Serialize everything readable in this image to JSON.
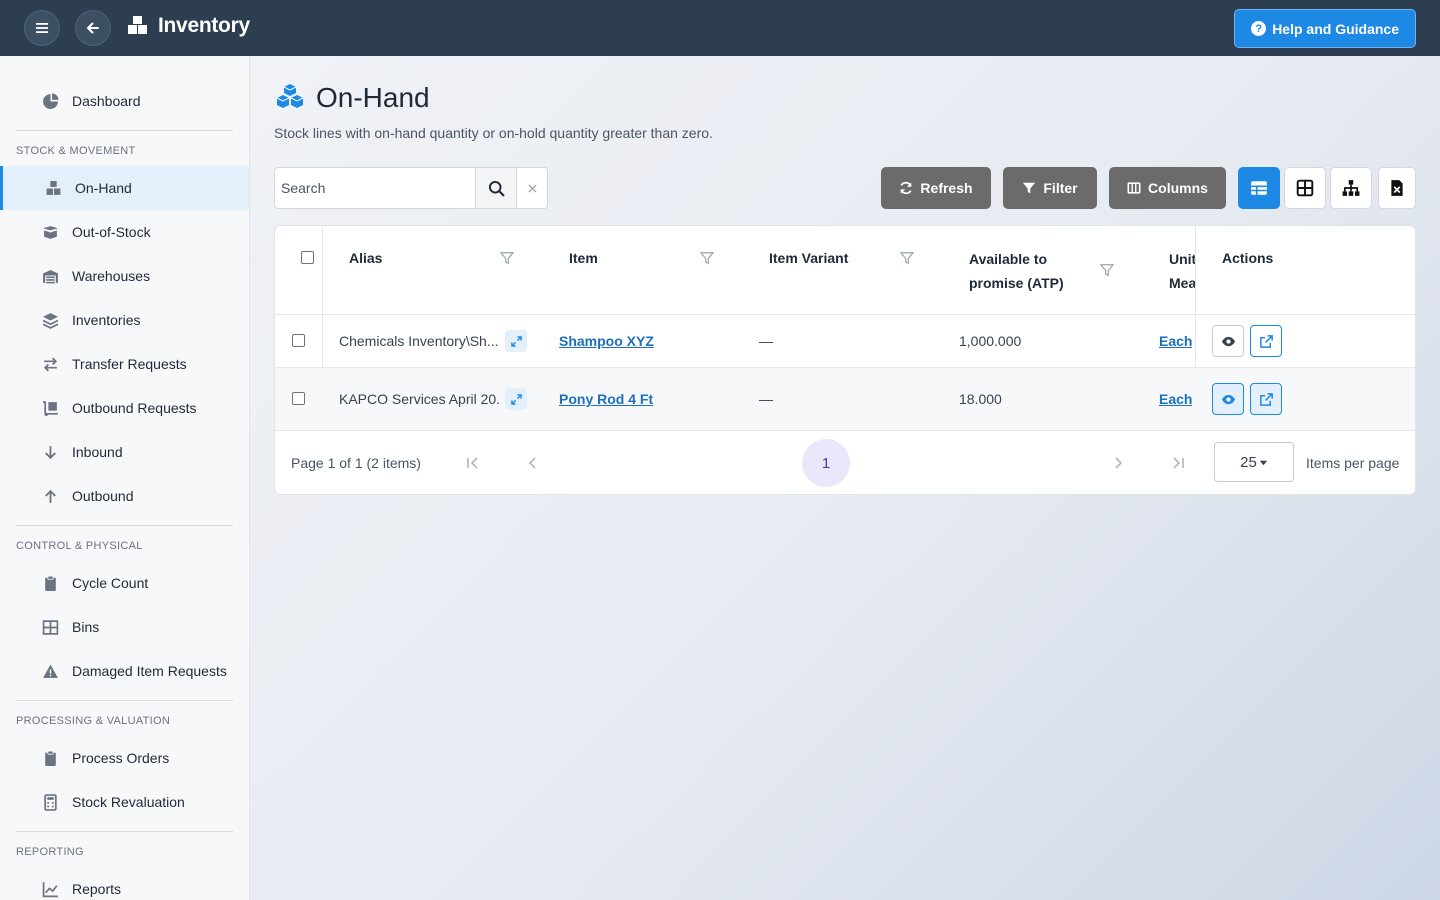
{
  "topbar": {
    "app_title": "Inventory",
    "help_label": "Help and Guidance",
    "menu_icon": "hamburger-icon",
    "back_icon": "arrow-left-icon"
  },
  "sidebar": {
    "dashboard": "Dashboard",
    "sections": [
      {
        "label": "STOCK & MOVEMENT"
      },
      {
        "label": "CONTROL & PHYSICAL"
      },
      {
        "label": "PROCESSING & VALUATION"
      },
      {
        "label": "REPORTING"
      }
    ],
    "items": [
      {
        "label": "On-Hand",
        "icon": "cubes-icon",
        "active": true
      },
      {
        "label": "Out-of-Stock",
        "icon": "open-box-icon"
      },
      {
        "label": "Warehouses",
        "icon": "warehouse-icon"
      },
      {
        "label": "Inventories",
        "icon": "layers-icon"
      },
      {
        "label": "Transfer Requests",
        "icon": "arrows-exchange-icon"
      },
      {
        "label": "Outbound Requests",
        "icon": "dolly-icon"
      },
      {
        "label": "Inbound",
        "icon": "arrow-down-icon"
      },
      {
        "label": "Outbound",
        "icon": "arrow-up-icon"
      },
      {
        "label": "Cycle Count",
        "icon": "clipboard-icon"
      },
      {
        "label": "Bins",
        "icon": "grid-icon"
      },
      {
        "label": "Damaged Item Requests",
        "icon": "warning-icon"
      },
      {
        "label": "Process Orders",
        "icon": "clipboard-icon"
      },
      {
        "label": "Stock Revaluation",
        "icon": "calculator-icon"
      },
      {
        "label": "Reports",
        "icon": "line-chart-icon"
      }
    ]
  },
  "page": {
    "title": "On-Hand",
    "subtitle": "Stock lines with on-hand quantity or on-hold quantity greater than zero."
  },
  "toolbar": {
    "search_placeholder": "Search",
    "search_value": "",
    "refresh_label": "Refresh",
    "filter_label": "Filter",
    "columns_label": "Columns"
  },
  "table": {
    "columns": {
      "alias": "Alias",
      "item": "Item",
      "variant": "Item Variant",
      "atp_line1": "Available to",
      "atp_line2": "promise (ATP)",
      "uom_line1": "Unit",
      "uom_line2": "Mea",
      "actions": "Actions"
    },
    "rows": [
      {
        "alias": "Chemicals Inventory\\Sh...",
        "item": "Shampoo XYZ",
        "variant": "—",
        "atp": "1,000.000",
        "uom": "Each"
      },
      {
        "alias": "KAPCO Services April 20...",
        "item": "Pony Rod 4 Ft",
        "variant": "—",
        "atp": "18.000",
        "uom": "Each"
      }
    ]
  },
  "pager": {
    "summary": "Page 1 of 1 (2 items)",
    "current_page": "1",
    "per_page": "25",
    "per_page_label": "Items per page"
  },
  "colors": {
    "topbar": "#2c3e50",
    "accent": "#1e88e5",
    "tool_button": "#6b6b6b"
  }
}
